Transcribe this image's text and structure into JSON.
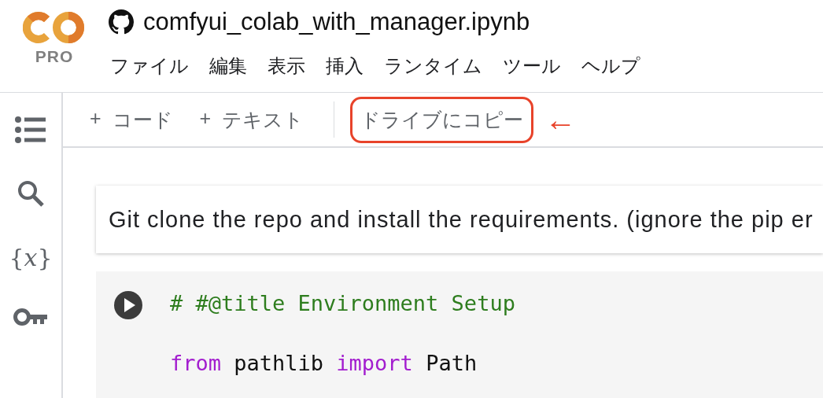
{
  "logo": {
    "badge": "PRO"
  },
  "notebook": {
    "title": "comfyui_colab_with_manager.ipynb"
  },
  "menu": [
    "ファイル",
    "編集",
    "表示",
    "挿入",
    "ランタイム",
    "ツール",
    "ヘルプ"
  ],
  "sidebar": [
    {
      "kind": "toc"
    },
    {
      "kind": "search"
    },
    {
      "kind": "variables",
      "glyph": "{*x*}"
    },
    {
      "kind": "secrets"
    }
  ],
  "toolbar": {
    "add_buttons": [
      {
        "plus": "+",
        "label": "コード"
      },
      {
        "plus": "+",
        "label": "テキスト"
      }
    ],
    "copy_button": {
      "label": "ドライブにコピー",
      "highlighted": true
    }
  },
  "annotation": {
    "arrow": "←"
  },
  "cells": [
    {
      "kind": "text",
      "text": "Git clone the repo and install the requirements. (ignore the pip er"
    },
    {
      "kind": "code",
      "paragraphs": [
        [
          [
            {
              "kind": "comment",
              "text": "# #@title Environment Setup"
            }
          ]
        ],
        [
          [
            {
              "kind": "keyword",
              "text": "from"
            },
            {
              "kind": "plain",
              "text": " pathlib "
            },
            {
              "kind": "keyword",
              "text": "import"
            },
            {
              "kind": "plain",
              "text": " Path"
            }
          ]
        ]
      ]
    }
  ]
}
